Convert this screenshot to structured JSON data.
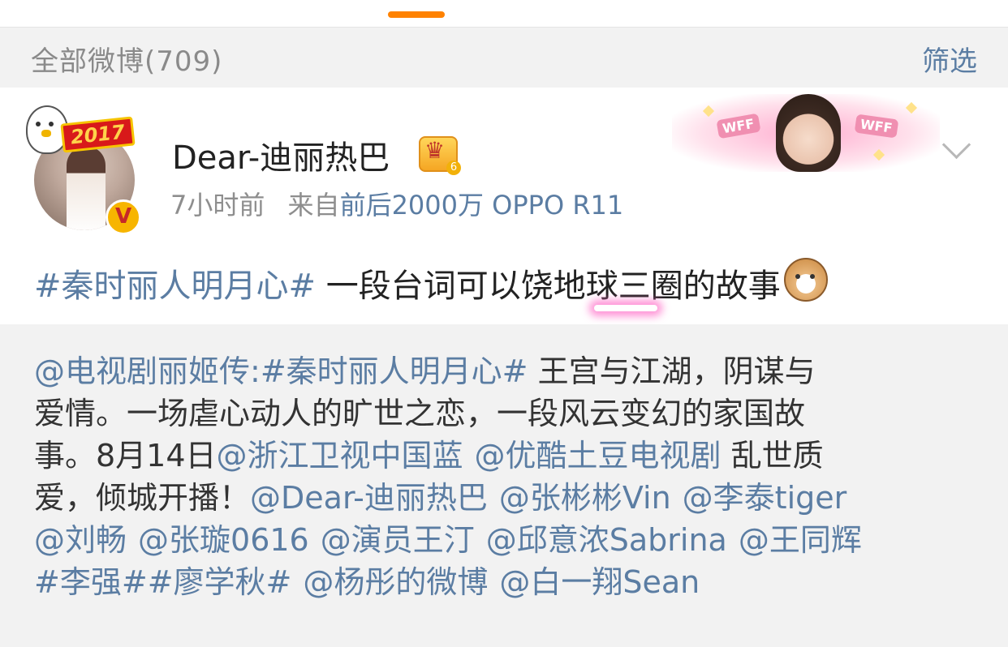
{
  "colors": {
    "link": "#5b7da3",
    "tab_indicator": "#ff8200",
    "filter_background": "#f2f2f2",
    "repost_background": "#f2f2f2",
    "verified_badge": "#f7b500"
  },
  "filter_bar": {
    "title": "全部微博(709)",
    "filter_label": "筛选"
  },
  "post": {
    "avatar_badge_year": "2017",
    "verified_glyph": "V",
    "username": "Dear-迪丽热巴",
    "member_icon": "crown-icon",
    "time": "7小时前",
    "source_prefix": "来自",
    "device": "前后2000万 OPPO R11",
    "fan_banner_tags": [
      "WFF",
      "WFF"
    ],
    "menu_icon": "chevron-down-icon",
    "hashtag": "#秦时丽人明月心#",
    "text": " 一段台词可以饶地球三圈的故事",
    "emoji": "cat-emoji-icon"
  },
  "repost": {
    "line1": {
      "mention": "@电视剧丽姬传:",
      "hashtag": "#秦时丽人明月心#",
      "text": " 王宫与江湖，阴谋与"
    },
    "line2": {
      "text": "爱情。一场虐心动人的旷世之恋，一段风云变幻的家国故"
    },
    "line3": {
      "text": "事。8月14日",
      "mention1": "@浙江卫视中国蓝",
      "mention2": "@优酷土豆电视剧",
      "text2": " 乱世质"
    },
    "line4": {
      "text": "爱，倾城开播！",
      "mention1": "@Dear-迪丽热巴",
      "mention2": "@张彬彬Vin",
      "mention3": "@李泰tiger"
    },
    "line5": {
      "mention1": "@刘畅",
      "mention2": "@张璇0616",
      "mention3": "@演员王汀",
      "mention4": "@邱意浓Sabrina",
      "mention5": "@王同辉"
    },
    "line6": {
      "hashtag1": "#李强#",
      "hashtag2": "#廖学秋#",
      "mention1": "@杨彤的微博",
      "mention2": "@白一翔Sean"
    }
  }
}
